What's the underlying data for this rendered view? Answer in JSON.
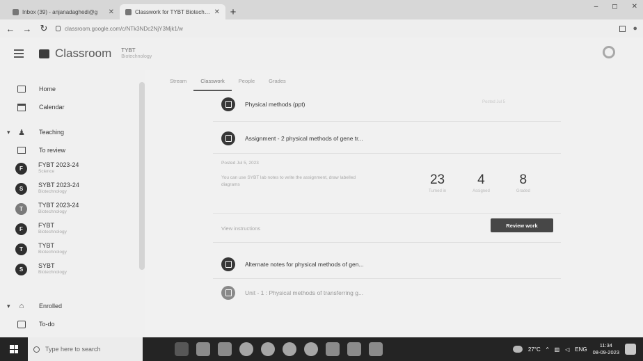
{
  "browser": {
    "tabs": [
      {
        "title": "Inbox (39) - anjanadaghedi@g",
        "active": false
      },
      {
        "title": "Classwork for TYBT Biotechnol",
        "active": true
      }
    ],
    "new_tab_label": "+",
    "url": "classroom.google.com/c/NTk3NDc2NjY3Mjk1/w",
    "window_controls": [
      "–",
      "◻",
      "✕"
    ]
  },
  "header": {
    "app_name": "Classroom",
    "crumb_title": "TYBT",
    "crumb_sub": "Biotechnology"
  },
  "sidebar": {
    "top_items": [
      {
        "label": "Home",
        "icon": "home-icon"
      },
      {
        "label": "Calendar",
        "icon": "calendar-icon"
      }
    ],
    "teaching_label": "Teaching",
    "to_review_label": "To review",
    "classes": [
      {
        "initial": "F",
        "name": "FYBT 2023-24",
        "sub": "Science",
        "dark": true
      },
      {
        "initial": "S",
        "name": "SYBT 2023-24",
        "sub": "Biotechnology",
        "dark": true
      },
      {
        "initial": "T",
        "name": "TYBT 2023-24",
        "sub": "Biotechnology",
        "dark": false
      },
      {
        "initial": "F",
        "name": "FYBT",
        "sub": "Biotechnology",
        "dark": true
      },
      {
        "initial": "T",
        "name": "TYBT",
        "sub": "Biotechnology",
        "dark": true
      },
      {
        "initial": "S",
        "name": "SYBT",
        "sub": "Biotechnology",
        "dark": true
      }
    ],
    "enrolled_label": "Enrolled",
    "todo_label": "To-do"
  },
  "main": {
    "tabs": [
      "Stream",
      "Classwork",
      "People",
      "Grades"
    ],
    "selected_tab": "Classwork",
    "items": [
      {
        "title": "Physical methods (ppt)",
        "faded": false
      },
      {
        "title": "Assignment - 2 physical methods of gene tr...",
        "faded": false
      },
      {
        "title": "Alternate notes for physical methods of gen...",
        "faded": false
      },
      {
        "title": "Unit - 1 : Physical methods of transferring g...",
        "faded": true
      }
    ],
    "posted_label": "Posted Jul 5, 2023",
    "description": "You can use SYBT lab notes to write the assignment, draw labelled diagrams",
    "stats": [
      {
        "value": "23",
        "label": "Turned in"
      },
      {
        "value": "4",
        "label": "Assigned"
      },
      {
        "value": "8",
        "label": "Graded"
      }
    ],
    "view_instructions": "View instructions",
    "review_button": "Review work",
    "right_date": "Posted Jul 5"
  },
  "taskbar": {
    "search_placeholder": "Type here to search",
    "weather": "27°C",
    "language": "ENG",
    "time": "11:34",
    "date": "08-09-2023"
  }
}
